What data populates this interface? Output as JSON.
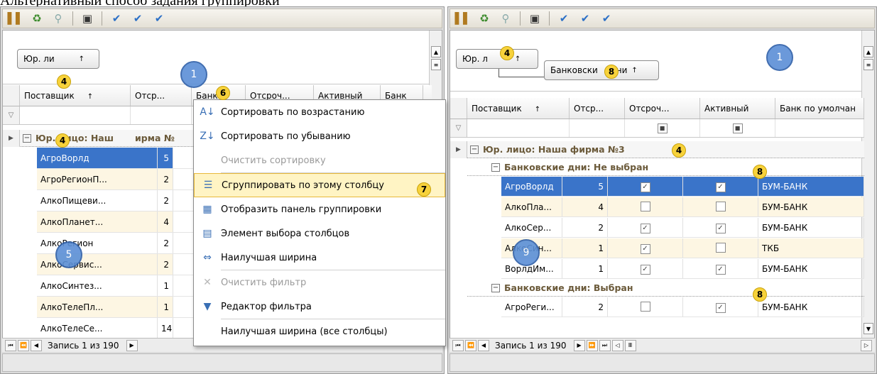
{
  "page_title": "Альтернативный способ задания группировки",
  "left": {
    "group_chip": "Юр. ли",
    "headers": [
      "Поставщик",
      "Отср...",
      "Банк",
      "Отсроч...",
      "Активный",
      "Банк"
    ],
    "group_row": "Юр. лицо: Наш",
    "group_row_tail": "ирма №",
    "rows": [
      {
        "name": "АгроВорлд",
        "num": "5"
      },
      {
        "name": "АгроРегионП...",
        "num": "2"
      },
      {
        "name": "АлкоПищеви...",
        "num": "2"
      },
      {
        "name": "АлкоПланет...",
        "num": "4"
      },
      {
        "name": "АлкоРегион",
        "num": "2"
      },
      {
        "name": "АлкоСервис...",
        "num": "2"
      },
      {
        "name": "АлкоСинтез...",
        "num": "1"
      },
      {
        "name": "АлкоТелеПл...",
        "num": "1"
      },
      {
        "name": "АлкоТелеСе...",
        "num": "14"
      }
    ],
    "nav_text": "Запись 1 из 190"
  },
  "menu": {
    "items": [
      {
        "label": "Сортировать по возрастанию",
        "icon": "sort-asc-icon",
        "glyph": "A↓"
      },
      {
        "label": "Сортировать по убыванию",
        "icon": "sort-desc-icon",
        "glyph": "Z↓"
      },
      {
        "label": "Очистить сортировку",
        "icon": "",
        "glyph": ""
      },
      {
        "label": "Сгруппировать по этому столбцу",
        "icon": "group-column-icon",
        "glyph": "☰"
      },
      {
        "label": "Отобразить панель группировки",
        "icon": "group-panel-icon",
        "glyph": "▦"
      },
      {
        "label": "Элемент выбора столбцов",
        "icon": "column-chooser-icon",
        "glyph": "▤"
      },
      {
        "label": "Наилучшая ширина",
        "icon": "best-fit-icon",
        "glyph": "⇔"
      },
      {
        "label": "Очистить фильтр",
        "icon": "clear-filter-icon",
        "glyph": "✕"
      },
      {
        "label": "Редактор фильтра",
        "icon": "filter-editor-icon",
        "glyph": "▼"
      },
      {
        "label": "Наилучшая ширина (все столбцы)",
        "icon": "",
        "glyph": ""
      }
    ]
  },
  "right": {
    "group_chip_1": "Юр. л",
    "group_chip_2_a": "Банковски",
    "group_chip_2_b": "ни",
    "headers": [
      "Поставщик",
      "Отср...",
      "Отсроч...",
      "Активный",
      "Банк по умолчан"
    ],
    "group_row_1": "Юр. лицо: Наша фирма №3",
    "group_row_2": "Банковские дни: Не выбран",
    "group_row_3": "Банковские дни: Выбран",
    "rows_a": [
      {
        "name": "АгроВорлд",
        "num": "5",
        "c1": true,
        "c2": true,
        "bank": "БУМ-БАНК"
      },
      {
        "name": "АлкоПла...",
        "num": "4",
        "c1": false,
        "c2": false,
        "bank": "БУМ-БАНК"
      },
      {
        "name": "АлкоСер...",
        "num": "2",
        "c1": true,
        "c2": true,
        "bank": "БУМ-БАНК"
      },
      {
        "name": "АлкоСин...",
        "num": "1",
        "c1": true,
        "c2": false,
        "bank": "ТКБ"
      },
      {
        "name": "ВорлдИм...",
        "num": "1",
        "c1": true,
        "c2": true,
        "bank": "БУМ-БАНК"
      }
    ],
    "rows_b": [
      {
        "name": "АгроРеги...",
        "num": "2",
        "c1": false,
        "c2": true,
        "bank": "БУМ-БАНК"
      }
    ],
    "nav_text": "Запись 1 из 190"
  },
  "markers": {
    "circle_1": "1",
    "circle_5": "5",
    "circle_9": "9",
    "badge_4": "4",
    "badge_6": "6",
    "badge_7": "7",
    "badge_8": "8"
  },
  "colors": {
    "selection": "#3a74c9",
    "group_text": "#6b5a3a",
    "badge": "#f7d23b",
    "callout": "#5b8fd6"
  }
}
